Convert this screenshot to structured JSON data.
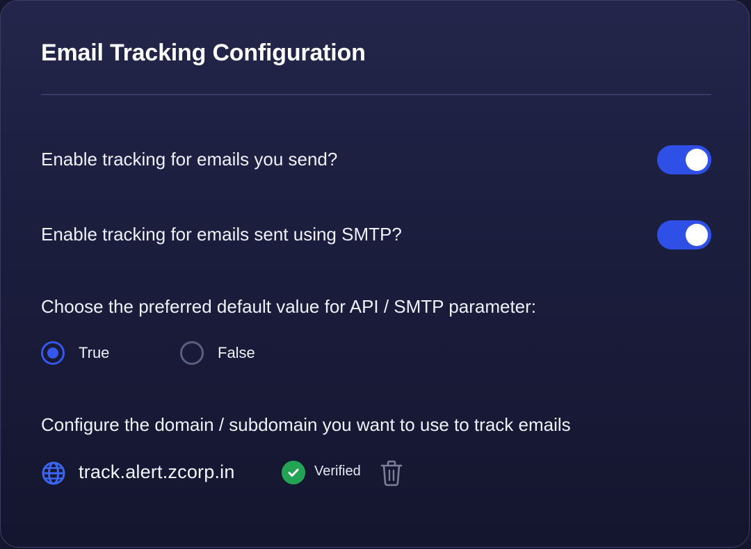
{
  "page_title": "Email Tracking Configuration",
  "settings": {
    "track_sent": {
      "label": "Enable tracking for emails you send?",
      "enabled": true
    },
    "track_smtp": {
      "label": "Enable tracking for emails sent using SMTP?",
      "enabled": true
    }
  },
  "default_value": {
    "label": "Choose the preferred default value for API / SMTP parameter:",
    "options": [
      {
        "label": "True",
        "selected": true
      },
      {
        "label": "False",
        "selected": false
      }
    ]
  },
  "domain": {
    "label": "Configure the domain / subdomain you want to use to track emails",
    "value": "track.alert.zcorp.in",
    "status": "Verified",
    "icons": [
      "globe-icon",
      "checkmark-icon",
      "trash-icon"
    ]
  },
  "colors": {
    "accent": "#2f50e6",
    "verified": "#23a455",
    "background": "#1b1d3d"
  }
}
